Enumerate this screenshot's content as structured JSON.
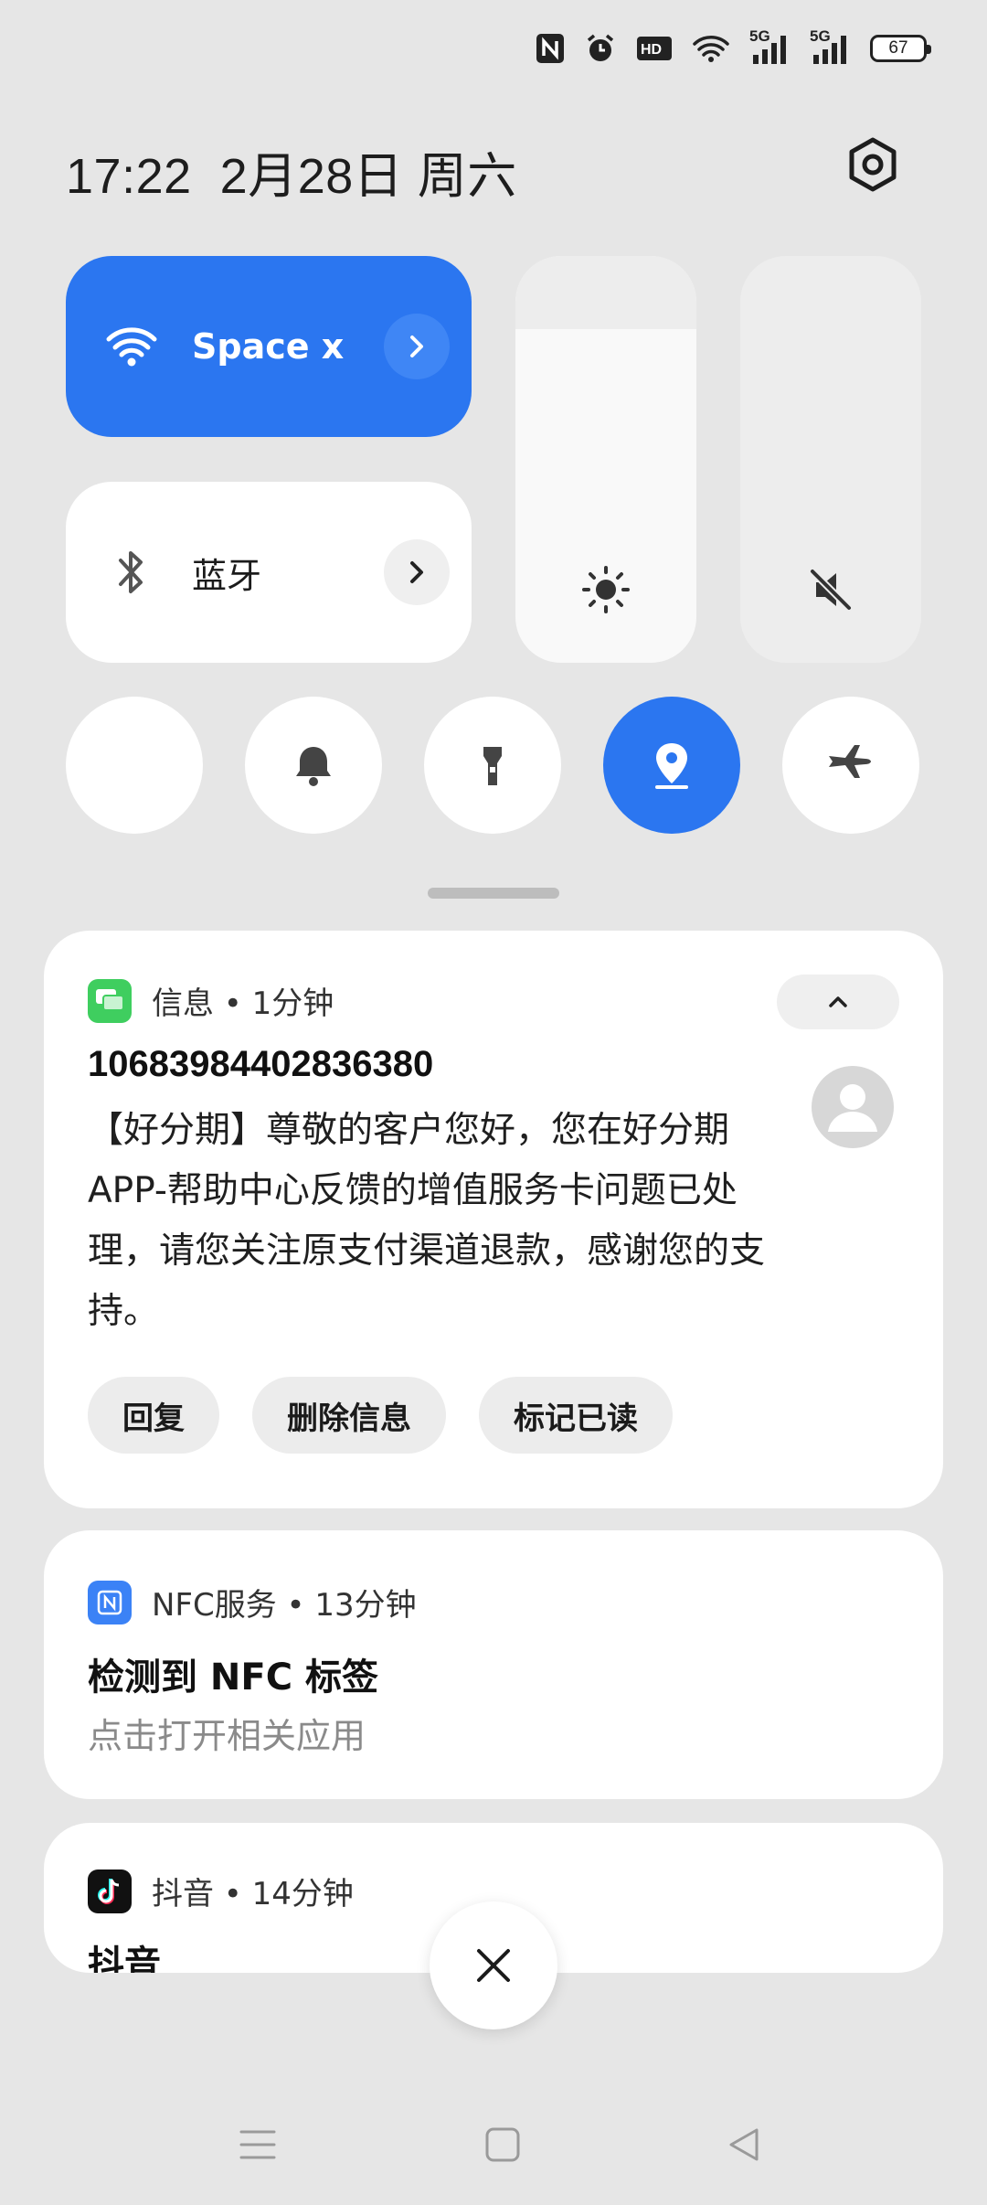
{
  "status_bar": {
    "icons": [
      "nfc-icon",
      "alarm-icon",
      "hd-voice-icon",
      "wifi-icon",
      "signal-5g-icon",
      "signal-5g-icon"
    ],
    "hd_label": "HD",
    "net_label_1": "5G",
    "net_label_2": "5G",
    "battery": "67"
  },
  "header": {
    "time": "17:22",
    "date": "2月28日",
    "weekday": "周六"
  },
  "quick_settings": {
    "wifi": {
      "label": "Space x",
      "state": "on"
    },
    "bluetooth": {
      "label": "蓝牙",
      "state": "off"
    },
    "brightness_level": 0.82,
    "volume_state": "muted",
    "toggles": [
      {
        "name": "mobile-data",
        "icon": "data-arrows-icon",
        "on": true
      },
      {
        "name": "ringer",
        "icon": "bell-icon",
        "on": false
      },
      {
        "name": "flashlight",
        "icon": "flashlight-icon",
        "on": false
      },
      {
        "name": "location",
        "icon": "location-pin-icon",
        "on": true
      },
      {
        "name": "airplane-mode",
        "icon": "airplane-icon",
        "on": false
      }
    ],
    "accent_color": "#2b76f0"
  },
  "notifications": {
    "sms": {
      "app": "信息 • 1分钟",
      "sender": "10683984402836380",
      "body": "【好分期】尊敬的客户您好，您在好分期APP-帮助中心反馈的增值服务卡问题已处理，请您关注原支付渠道退款，感谢您的支持。",
      "actions": [
        "回复",
        "删除信息",
        "标记已读"
      ]
    },
    "nfc": {
      "app": "NFC服务 • 13分钟",
      "title": "检测到 NFC 标签",
      "subtitle": "点击打开相关应用"
    },
    "douyin": {
      "app": "抖音 • 14分钟",
      "title": "抖音"
    }
  },
  "nav_bar": [
    "menu-icon",
    "home-icon",
    "back-icon"
  ]
}
